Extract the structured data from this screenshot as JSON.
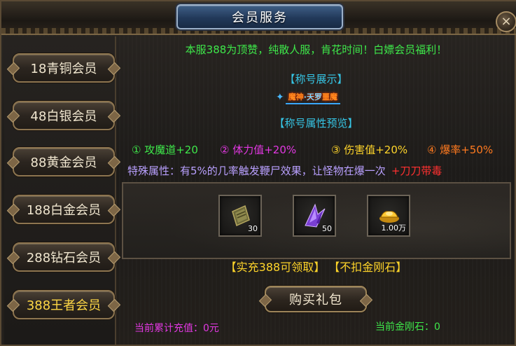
{
  "window": {
    "title": "会员服务",
    "close_glyph": "×"
  },
  "sidebar": {
    "items": [
      {
        "label": "18青铜会员",
        "active": false
      },
      {
        "label": "48白银会员",
        "active": false
      },
      {
        "label": "88黄金会员",
        "active": false
      },
      {
        "label": "188白金会员",
        "active": false
      },
      {
        "label": "288钻石会员",
        "active": false
      },
      {
        "label": "388王者会员",
        "active": true
      }
    ]
  },
  "main": {
    "announcement": "本服388为顶赞，纯散人服，肯花时间！白嫖会员福利！",
    "title_showcase_heading": "【称号展示】",
    "title_badge": {
      "name_a": "魔神",
      "name_b": "天罗",
      "name_c": "噩魔",
      "separator": "·"
    },
    "attr_preview_heading": "【称号属性预览】",
    "attributes": [
      {
        "text": "① 攻魔道+20",
        "color": "#3ee84a"
      },
      {
        "text": "② 体力值+20%",
        "color": "#e238e2"
      },
      {
        "text": "③ 伤害值+20%",
        "color": "#ffd52a"
      },
      {
        "text": "④ 爆率+50%",
        "color": "#ff7a1f"
      }
    ],
    "special_attr": "特殊属性：有5%的几率触发鞭尸效果，让怪物在爆一次",
    "special_bonus": "+刀刀带毒",
    "rewards": [
      {
        "icon": "scroll-icon",
        "qty": "30"
      },
      {
        "icon": "purple-crystal-icon",
        "qty": "50"
      },
      {
        "icon": "gold-ingot-icon",
        "qty": "1.00万"
      }
    ],
    "claim_text": "【实充388可领取】 【不扣金刚石】",
    "buy_button": "购买礼包",
    "recharge_total": "当前累计充值：0元",
    "diamond_balance": "当前金刚石：0"
  },
  "colors": {
    "accent_green": "#3ee84a",
    "accent_cyan": "#36c6e6",
    "accent_gold": "#ffd52a",
    "accent_magenta": "#e238e2",
    "accent_red": "#ff3030"
  }
}
